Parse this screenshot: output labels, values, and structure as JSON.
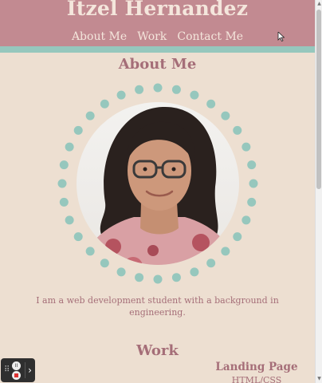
{
  "header": {
    "title": "Itzel Hernandez",
    "nav": [
      "About Me",
      "Work",
      "Contact Me"
    ]
  },
  "about": {
    "title": "About Me",
    "bio": "I am a web development student with a background in engineering."
  },
  "work": {
    "title": "Work",
    "project_title": "Landing Page",
    "project_tech": "HTML/CSS"
  },
  "icons": {
    "cursor": "mouse-pointer-icon",
    "recorder_pause": "pause-icon",
    "recorder_stop": "stop-record-icon",
    "recorder_expand": "chevron-right-icon",
    "recorder_drag": "drag-handle-icon"
  },
  "recorder": {
    "pause_symbol": "II",
    "grip_symbol": "⠿",
    "expand_symbol": "›"
  },
  "colors": {
    "header": "#c28a91",
    "accent_teal": "#96c7bd",
    "background": "#eddfd1",
    "heading_text": "#a56e78"
  }
}
